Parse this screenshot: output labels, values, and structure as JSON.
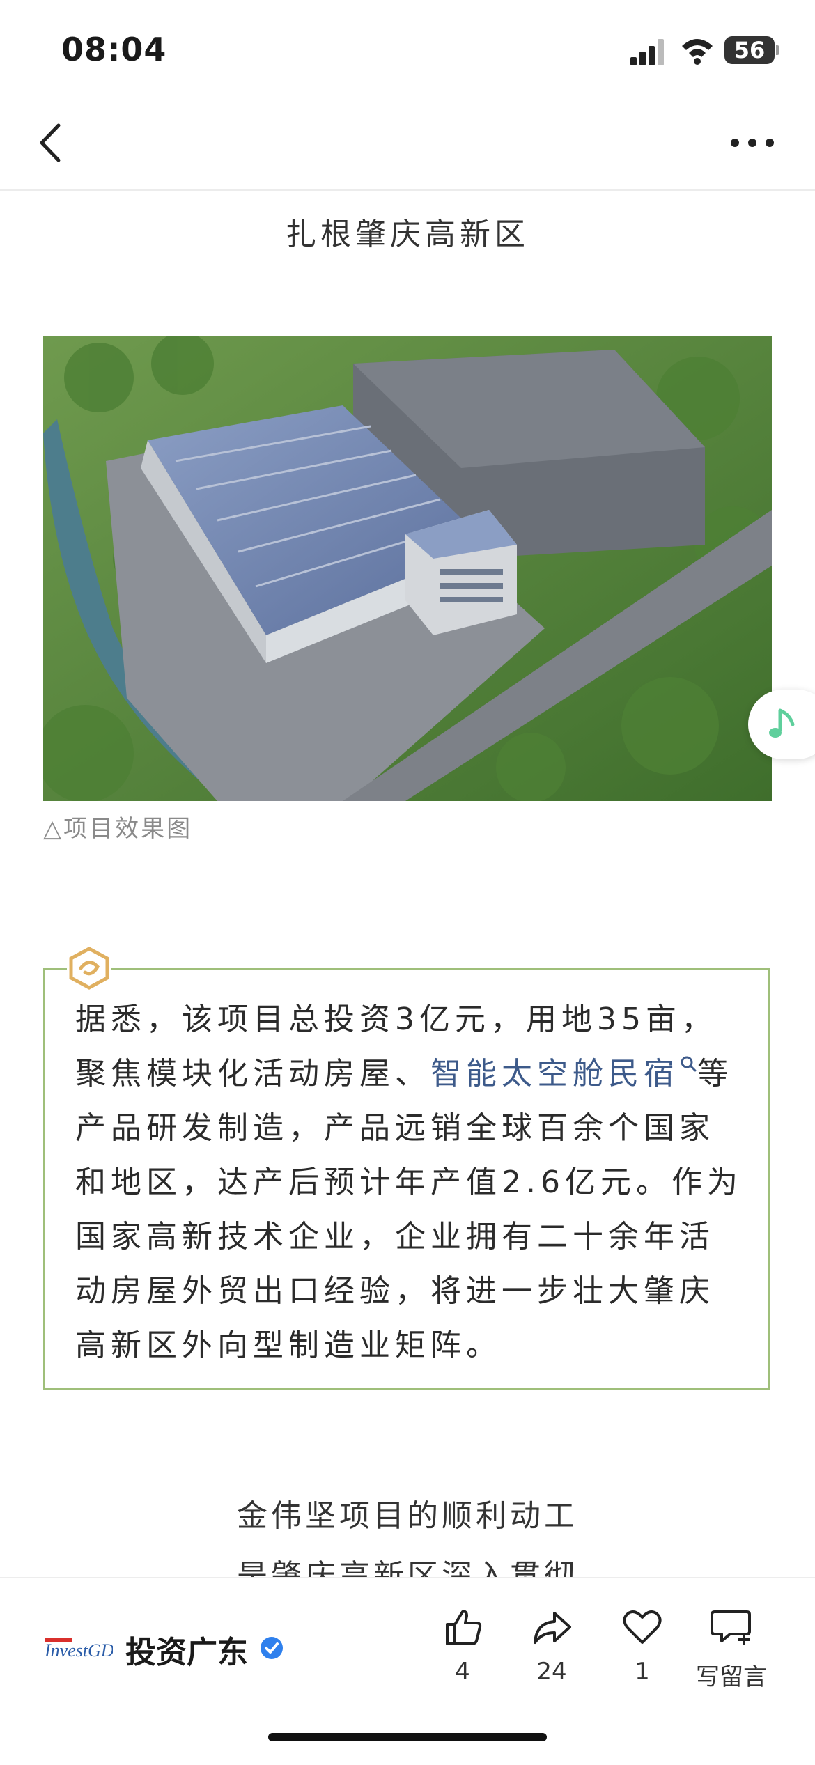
{
  "status_bar": {
    "time": "08:04",
    "battery": "56"
  },
  "article": {
    "section_title": "扎根肇庆高新区",
    "image_caption": "△项目效果图",
    "quote_part1": "据悉，该项目总投资3亿元，用地35亩，聚焦模块化活动房屋、",
    "quote_link": "智能太空舱民宿",
    "quote_part2": "等产品研发制造，产品远销全球百余个国家和地区，达产后预计年产值2.6亿元。作为国家高新技术企业，企业拥有二十余年活动房屋外贸出口经验，将进一步壮大肇庆高新区外向型制造业矩阵。",
    "sub_heading": "金伟坚项目的顺利动工",
    "sub_heading_2": "是肇庆高新区深入贯彻"
  },
  "bottom_bar": {
    "logo_text": "InvestGD",
    "account_name": "投资广东",
    "like_count": "4",
    "share_count": "24",
    "favorite_count": "1",
    "comment_label": "写留言"
  },
  "colors": {
    "link": "#3d5a8a",
    "quote_border": "#9fbf7a",
    "verified": "#2f80ed"
  }
}
